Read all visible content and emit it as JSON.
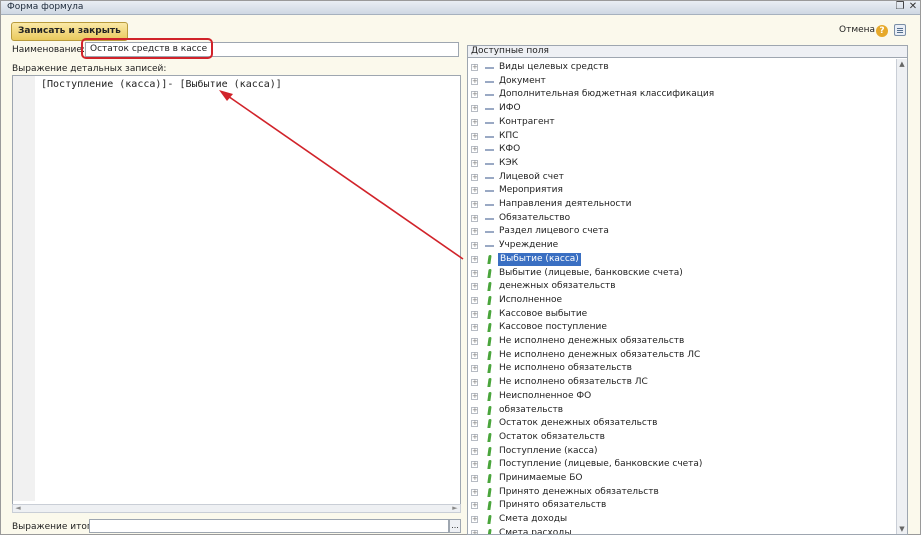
{
  "window": {
    "title": "Форма формула"
  },
  "toolbar": {
    "save_close": "Записать и закрыть",
    "cancel": "Отмена",
    "help": "?"
  },
  "form": {
    "name_label": "Наименование:",
    "name_value": "Остаток средств в кассе",
    "expr_label": "Выражение детальных записей:",
    "expr_value": "[Поступление (касса)]- [Выбытие (касса)]",
    "total_label": "Выражение итогов:",
    "dots": "..."
  },
  "fields": {
    "header": "Доступные поля",
    "items": [
      {
        "label": "Виды целевых средств",
        "icon": "dash"
      },
      {
        "label": "Документ",
        "icon": "dash"
      },
      {
        "label": "Дополнительная бюджетная классификация",
        "icon": "dash"
      },
      {
        "label": "ИФО",
        "icon": "dash"
      },
      {
        "label": "Контрагент",
        "icon": "dash"
      },
      {
        "label": "КПС",
        "icon": "dash"
      },
      {
        "label": "КФО",
        "icon": "dash"
      },
      {
        "label": "КЭК",
        "icon": "dash"
      },
      {
        "label": "Лицевой счет",
        "icon": "dash"
      },
      {
        "label": "Мероприятия",
        "icon": "dash"
      },
      {
        "label": "Направления деятельности",
        "icon": "dash"
      },
      {
        "label": "Обязательство",
        "icon": "dash"
      },
      {
        "label": "Раздел лицевого счета",
        "icon": "dash"
      },
      {
        "label": "Учреждение",
        "icon": "dash"
      },
      {
        "label": "Выбытие (касса)",
        "icon": "leaf",
        "selected": true
      },
      {
        "label": "Выбытие (лицевые, банковские счета)",
        "icon": "leaf"
      },
      {
        "label": "денежных обязательств",
        "icon": "leaf"
      },
      {
        "label": "Исполненное",
        "icon": "leaf"
      },
      {
        "label": "Кассовое выбытие",
        "icon": "leaf"
      },
      {
        "label": "Кассовое поступление",
        "icon": "leaf"
      },
      {
        "label": "Не исполнено денежных обязательств",
        "icon": "leaf"
      },
      {
        "label": "Не исполнено денежных обязательств ЛС",
        "icon": "leaf"
      },
      {
        "label": "Не исполнено обязательств",
        "icon": "leaf"
      },
      {
        "label": "Не исполнено обязательств ЛС",
        "icon": "leaf"
      },
      {
        "label": "Неисполненное ФО",
        "icon": "leaf"
      },
      {
        "label": "обязательств",
        "icon": "leaf"
      },
      {
        "label": "Остаток денежных обязательств",
        "icon": "leaf"
      },
      {
        "label": "Остаток обязательств",
        "icon": "leaf"
      },
      {
        "label": "Поступление (касса)",
        "icon": "leaf"
      },
      {
        "label": "Поступление (лицевые, банковские счета)",
        "icon": "leaf"
      },
      {
        "label": "Принимаемые БО",
        "icon": "leaf"
      },
      {
        "label": "Принято денежных обязательств",
        "icon": "leaf"
      },
      {
        "label": "Принято обязательств",
        "icon": "leaf"
      },
      {
        "label": "Смета доходы",
        "icon": "leaf"
      },
      {
        "label": "Смета расходы",
        "icon": "leaf"
      }
    ]
  },
  "colors": {
    "highlight": "#d1232a",
    "selection": "#3a6fc2",
    "accent_button": "#e9c95e"
  },
  "icons": [
    "restore-icon",
    "close-icon",
    "help-icon",
    "menu-icon",
    "expand-icon",
    "dimension-icon",
    "resource-icon",
    "arrow-icon"
  ]
}
